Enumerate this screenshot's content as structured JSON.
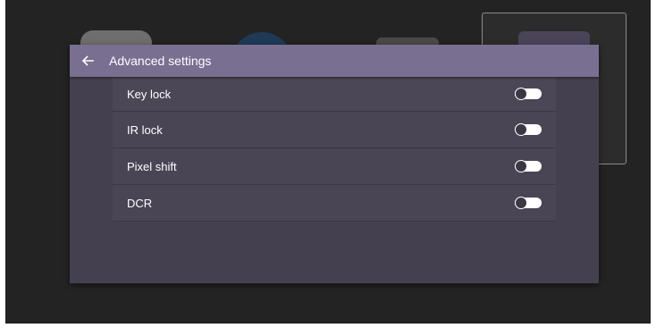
{
  "dialog": {
    "title": "Advanced settings",
    "back_icon": "arrow-left-icon"
  },
  "settings": [
    {
      "label": "Key lock",
      "enabled": false
    },
    {
      "label": "IR lock",
      "enabled": false
    },
    {
      "label": "Pixel shift",
      "enabled": false
    },
    {
      "label": "DCR",
      "enabled": false
    }
  ],
  "colors": {
    "header": "#786f91",
    "panel": "#45404f",
    "backdrop": "#232323"
  }
}
